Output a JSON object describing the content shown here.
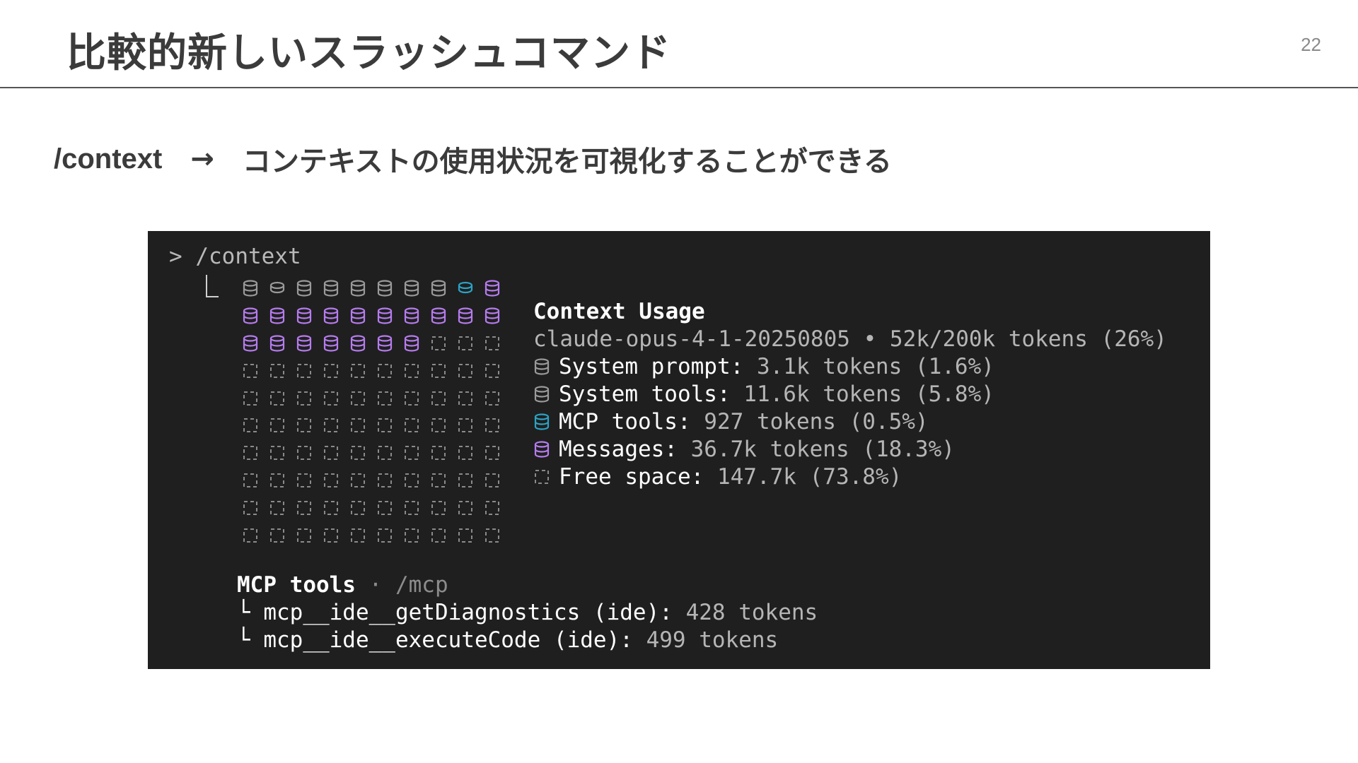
{
  "slide": {
    "title": "比較的新しいスラッシュコマンド",
    "page_number": "22",
    "subtitle_command": "/context",
    "subtitle_arrow": "→",
    "subtitle_text": "コンテキストの使用状況を可視化することができる"
  },
  "terminal": {
    "prompt": "> /context",
    "grid_rows": [
      [
        "system",
        "system-half",
        "system",
        "system",
        "system",
        "system",
        "system",
        "system",
        "mcp-half",
        "messages"
      ],
      [
        "messages",
        "messages",
        "messages",
        "messages",
        "messages",
        "messages",
        "messages",
        "messages",
        "messages",
        "messages"
      ],
      [
        "messages",
        "messages",
        "messages",
        "messages",
        "messages",
        "messages",
        "messages",
        "free",
        "free",
        "free"
      ],
      [
        "free",
        "free",
        "free",
        "free",
        "free",
        "free",
        "free",
        "free",
        "free",
        "free"
      ],
      [
        "free",
        "free",
        "free",
        "free",
        "free",
        "free",
        "free",
        "free",
        "free",
        "free"
      ],
      [
        "free",
        "free",
        "free",
        "free",
        "free",
        "free",
        "free",
        "free",
        "free",
        "free"
      ],
      [
        "free",
        "free",
        "free",
        "free",
        "free",
        "free",
        "free",
        "free",
        "free",
        "free"
      ],
      [
        "free",
        "free",
        "free",
        "free",
        "free",
        "free",
        "free",
        "free",
        "free",
        "free"
      ],
      [
        "free",
        "free",
        "free",
        "free",
        "free",
        "free",
        "free",
        "free",
        "free",
        "free"
      ],
      [
        "free",
        "free",
        "free",
        "free",
        "free",
        "free",
        "free",
        "free",
        "free",
        "free"
      ]
    ],
    "context_title": "Context Usage",
    "context_model_line": "claude-opus-4-1-20250805 • 52k/200k tokens (26%)",
    "legend": [
      {
        "icon": "system",
        "label": "System prompt:",
        "value": " 3.1k tokens (1.6%)"
      },
      {
        "icon": "system",
        "label": "System tools:",
        "value": " 11.6k tokens (5.8%)"
      },
      {
        "icon": "mcp",
        "label": "MCP tools:",
        "value": " 927 tokens (0.5%)"
      },
      {
        "icon": "messages",
        "label": "Messages:",
        "value": " 36.7k tokens (18.3%)"
      },
      {
        "icon": "free",
        "label": "Free space:",
        "value": " 147.7k (73.8%)"
      }
    ],
    "mcp_section": {
      "title": "MCP tools",
      "separator": " · ",
      "command": "/mcp",
      "items": [
        {
          "prefix": "└ ",
          "name": "mcp__ide__getDiagnostics (ide):",
          "tokens": " 428 tokens"
        },
        {
          "prefix": "└ ",
          "name": "mcp__ide__executeCode (ide):",
          "tokens": " 499 tokens"
        }
      ]
    },
    "colors": {
      "system": "#9a9a9a",
      "mcp": "#2ba3c4",
      "messages": "#b77cf0",
      "free": "#8a8a8a"
    }
  }
}
